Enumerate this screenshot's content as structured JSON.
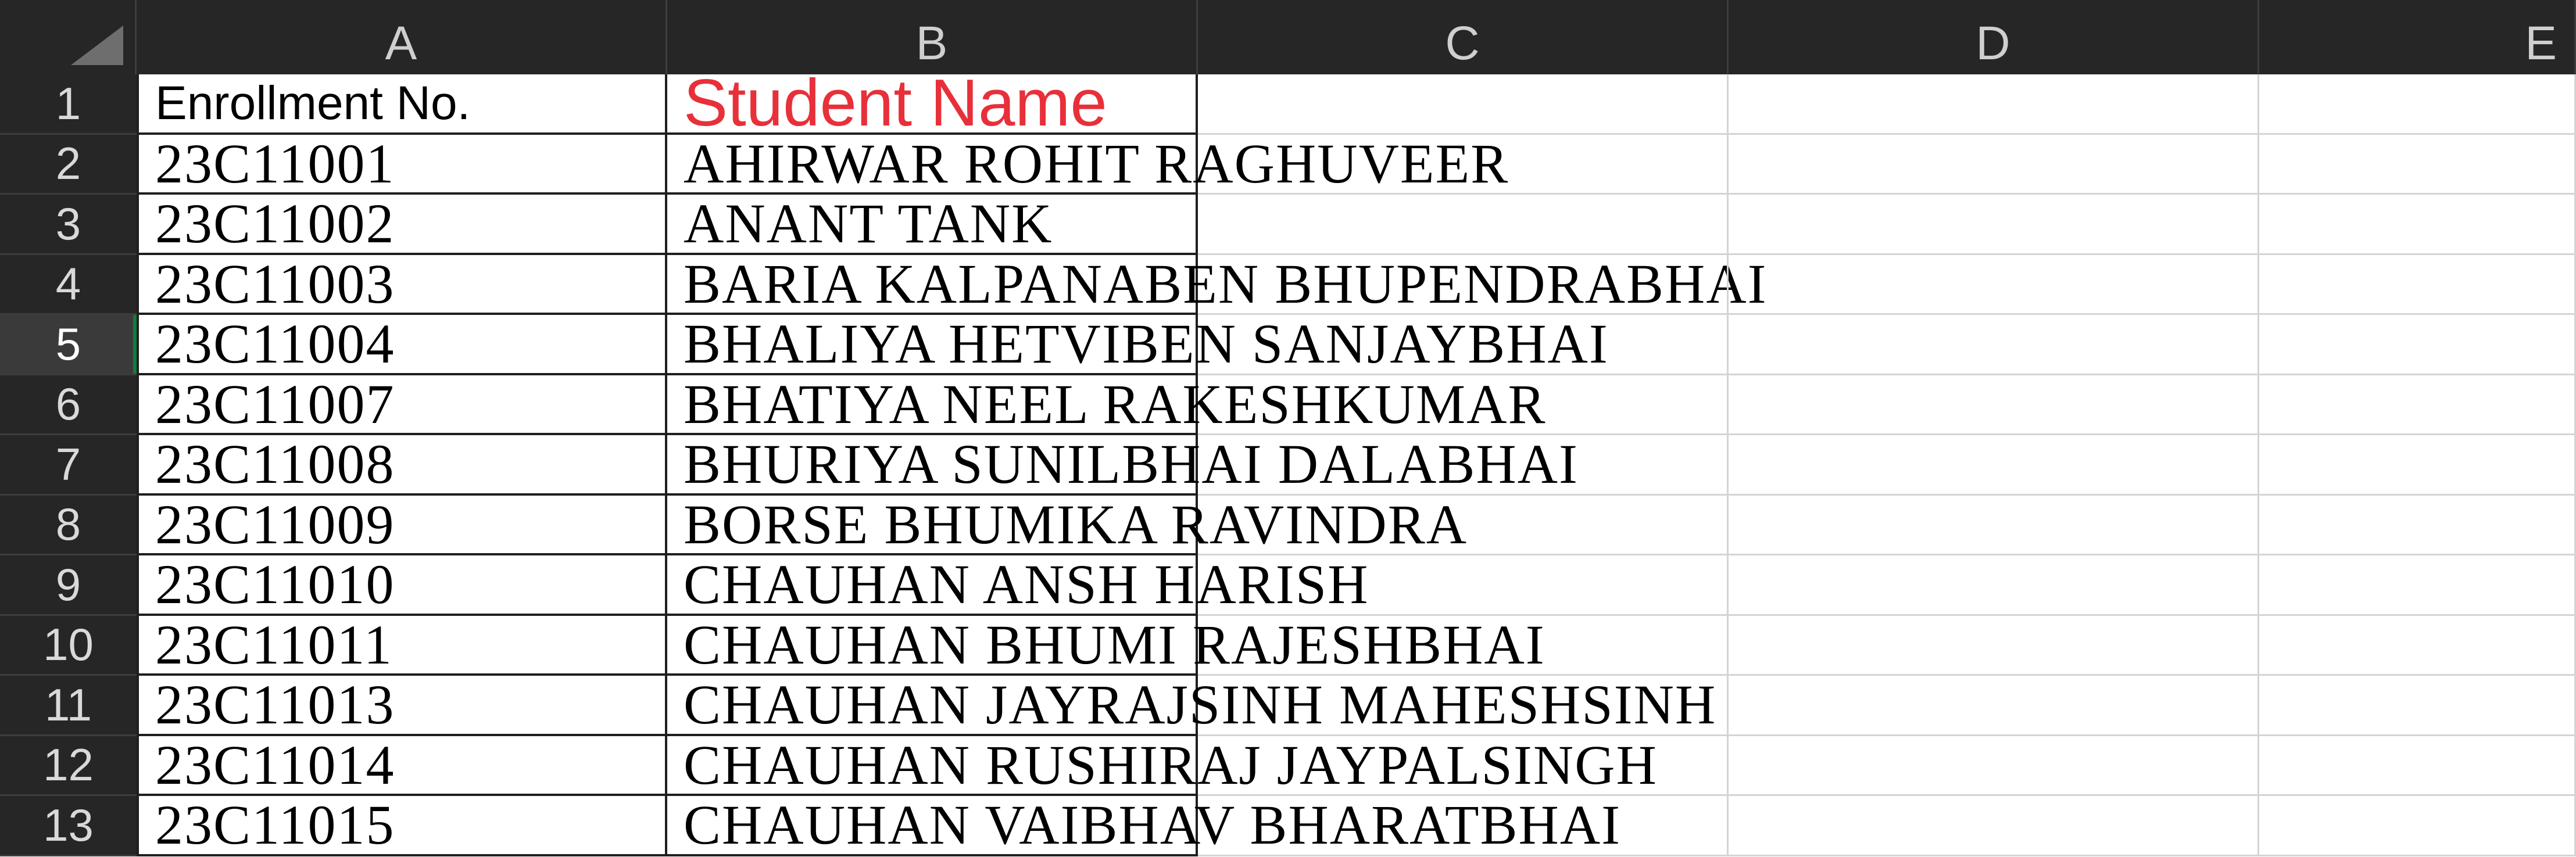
{
  "columns": [
    "A",
    "B",
    "C",
    "D",
    "E"
  ],
  "rows": [
    "1",
    "2",
    "3",
    "4",
    "5",
    "6",
    "7",
    "8",
    "9",
    "10",
    "11",
    "12",
    "13"
  ],
  "active_row": "5",
  "header": {
    "enrollment_label": "Enrollment No.",
    "student_name_label": "Student Name",
    "student_name_color": "#e8303a"
  },
  "records": [
    {
      "enrollment": "23C11001",
      "name": "AHIRWAR ROHIT RAGHUVEER"
    },
    {
      "enrollment": "23C11002",
      "name": "ANANT TANK"
    },
    {
      "enrollment": "23C11003",
      "name": "BARIA KALPANABEN BHUPENDRABHAI"
    },
    {
      "enrollment": "23C11004",
      "name": "BHALIYA HETVIBEN SANJAYBHAI"
    },
    {
      "enrollment": "23C11007",
      "name": "BHATIYA NEEL RAKESHKUMAR"
    },
    {
      "enrollment": "23C11008",
      "name": "BHURIYA SUNILBHAI DALABHAI"
    },
    {
      "enrollment": "23C11009",
      "name": "BORSE BHUMIKA RAVINDRA"
    },
    {
      "enrollment": "23C11010",
      "name": "CHAUHAN ANSH HARISH"
    },
    {
      "enrollment": "23C11011",
      "name": "CHAUHAN BHUMI RAJESHBHAI"
    },
    {
      "enrollment": "23C11013",
      "name": "CHAUHAN JAYRAJSINH MAHESHSINH"
    },
    {
      "enrollment": "23C11014",
      "name": "CHAUHAN RUSHIRAJ JAYPALSINGH"
    },
    {
      "enrollment": "23C11015",
      "name": "CHAUHAN VAIBHAV BHARATBHAI"
    }
  ]
}
